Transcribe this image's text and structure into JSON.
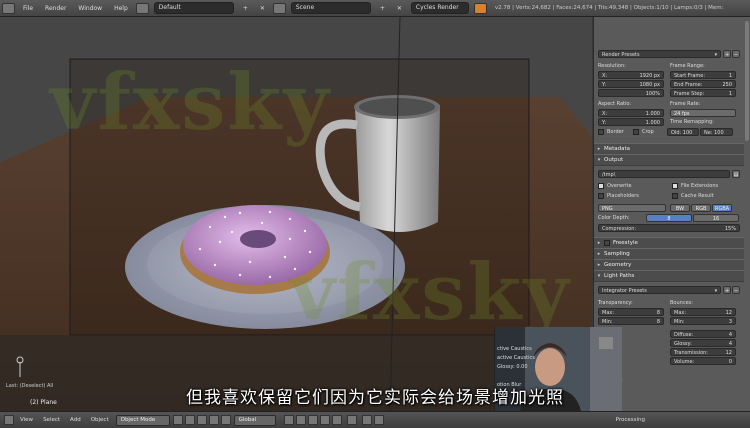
{
  "topbar": {
    "menu": [
      "File",
      "Render",
      "Window",
      "Help"
    ],
    "layout_value": "Default",
    "scene_value": "Scene",
    "engine_value": "Cycles Render",
    "stats": "v2.78 | Verts:24,682 | Faces:24,674 | Tris:49,348 | Objects:1/10 | Lamps:0/3 | Mem:"
  },
  "viewport": {
    "watermark": "vfxsky",
    "last_op": "Last: (Deselect) All",
    "object_label": "(2) Plane"
  },
  "props": {
    "render_presets": "Render Presets",
    "resolution_label": "Resolution:",
    "res_x": {
      "k": "X:",
      "v": "1920 px"
    },
    "res_y": {
      "k": "Y:",
      "v": "1080 px"
    },
    "res_pct": "100%",
    "frame_range_label": "Frame Range:",
    "start_frame": {
      "k": "Start Frame:",
      "v": "1"
    },
    "end_frame": {
      "k": "End Frame:",
      "v": "250"
    },
    "frame_step": {
      "k": "Frame Step:",
      "v": "1"
    },
    "aspect_label": "Aspect Ratio:",
    "aspect_x": {
      "k": "X:",
      "v": "1.000"
    },
    "aspect_y": {
      "k": "Y:",
      "v": "1.000"
    },
    "frame_rate_label": "Frame Rate:",
    "fps": "24 fps",
    "time_remap_label": "Time Remapping:",
    "old": "Old: 100",
    "new": "Ne: 100",
    "border": "Border",
    "crop": "Crop",
    "metadata": "Metadata",
    "output": "Output",
    "output_path": "/tmp\\",
    "overwrite": "Overwrite",
    "file_ext": "File Extensions",
    "placeholders": "Placeholders",
    "cache_result": "Cache Result",
    "format": "PNG",
    "bw": "BW",
    "rgb": "RGB",
    "rgba": "RGBA",
    "color_depth": "Color Depth:",
    "depth_8": "8",
    "depth_16": "16",
    "compression": "Compression:",
    "compression_val": "15%",
    "freestyle": "Freestyle",
    "sampling": "Sampling",
    "geometry": "Geometry",
    "light_paths": "Light Paths",
    "integrator_presets": "Integrator Presets",
    "transparency": "Transparency:",
    "bounces": "Bounces:",
    "t_max": {
      "k": "Max:",
      "v": "8"
    },
    "t_min": {
      "k": "Min:",
      "v": "8"
    },
    "b_max": {
      "k": "Max:",
      "v": "12"
    },
    "b_min": {
      "k": "Min:",
      "v": "3"
    },
    "diffuse": {
      "k": "Diffuse:",
      "v": "4"
    },
    "glossy": {
      "k": "Glossy:",
      "v": "4"
    },
    "transmission": {
      "k": "Transmission:",
      "v": "12"
    },
    "volume": {
      "k": "Volume:",
      "v": "0"
    },
    "caustics_left_1": "ctive Caustics",
    "caustics_left_2": "active Caustics",
    "caustics_glossy": "Glossy: 0.00",
    "motion_blur": "otion Blur",
    "performance": "rmance",
    "post_processing": "Processing"
  },
  "bottombar": {
    "view": "View",
    "select": "Select",
    "add": "Add",
    "object": "Object",
    "mode": "Object Mode",
    "orientation": "Global"
  },
  "subtitle": "但我喜欢保留它们因为它实际会给场景增加光照",
  "colors": {
    "panel_bg": "#5a5a5a",
    "viewport_bg": "#464646",
    "accent_blue": "#5680c2",
    "donut_icing": "#c79ad6"
  }
}
